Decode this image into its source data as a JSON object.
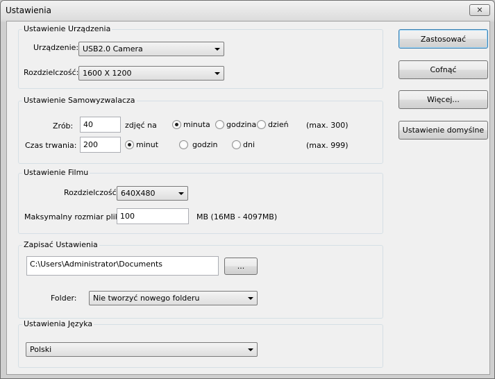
{
  "window": {
    "title": "Ustawienia",
    "close_icon": "✕"
  },
  "device": {
    "group_title": "Ustawienie Urządzenia",
    "device_label": "Urządzenie:",
    "device_value": "USB2.0 Camera",
    "resolution_label": "Rozdzielczość:",
    "resolution_value": "1600 X 1200"
  },
  "timer": {
    "group_title": "Ustawienie Samowyzwalacza",
    "shots_label": "Zrób:",
    "shots_value": "40",
    "shots_unit": "zdjęć na",
    "per_options": [
      {
        "label": "minuta",
        "checked": true
      },
      {
        "label": "godzina",
        "checked": false
      },
      {
        "label": "dzień",
        "checked": false
      }
    ],
    "shots_max": "(max. 300)",
    "duration_label": "Czas trwania:",
    "duration_value": "200",
    "duration_options": [
      {
        "label": "minut",
        "checked": true
      },
      {
        "label": "godzin",
        "checked": false
      },
      {
        "label": "dni",
        "checked": false
      }
    ],
    "duration_max": "(max. 999)"
  },
  "movie": {
    "group_title": "Ustawienie Filmu",
    "resolution_label": "Rozdzielczość:",
    "resolution_value": "640X480",
    "maxsize_label": "Maksymalny rozmiar pliku:",
    "maxsize_value": "100",
    "maxsize_range": "MB (16MB - 4097MB)"
  },
  "save": {
    "group_title": "Zapisać Ustawienia",
    "path_value": "C:\\Users\\Administrator\\Documents",
    "browse_label": "...",
    "folder_label": "Folder:",
    "folder_value": "Nie tworzyć nowego folderu"
  },
  "language": {
    "group_title": "Ustawienia Języka",
    "language_value": "Polski"
  },
  "buttons": {
    "apply": "Zastosować",
    "cancel": "Cofnąć",
    "more": "Więcej...",
    "defaults": "Ustawienie domyślne"
  }
}
